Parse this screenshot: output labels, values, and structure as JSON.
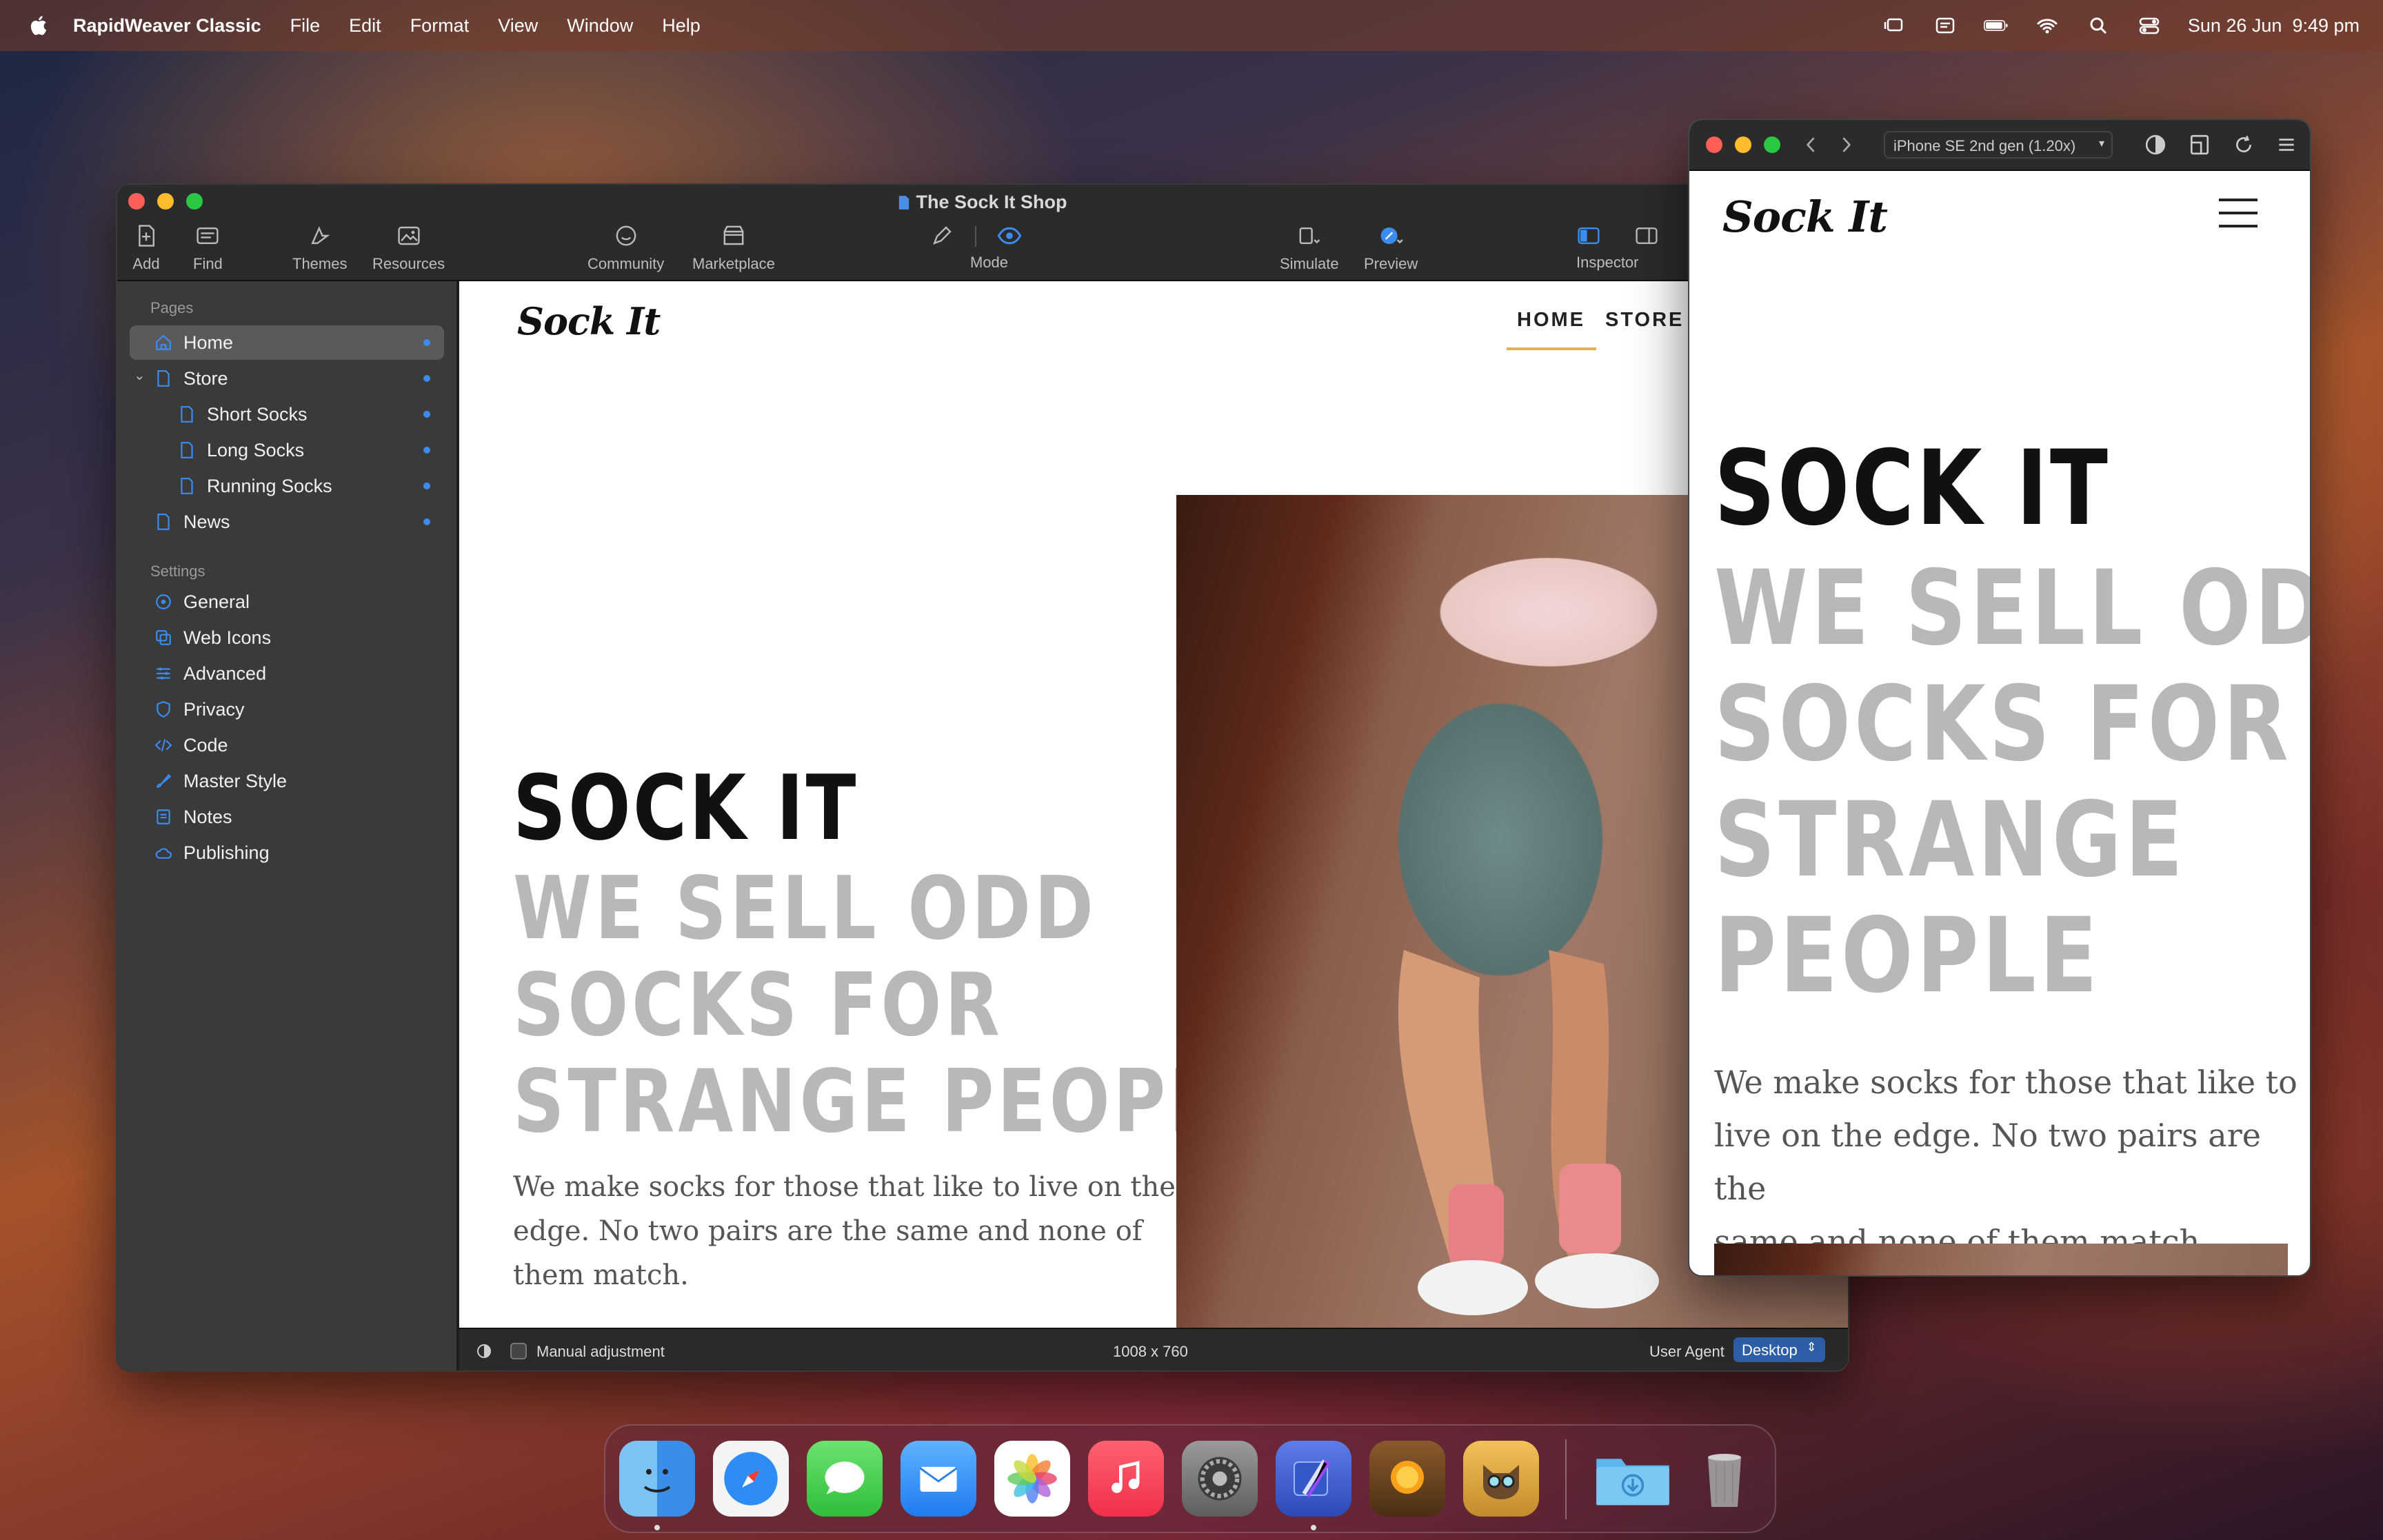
{
  "menubar": {
    "app_name": "RapidWeaver Classic",
    "menus": [
      "File",
      "Edit",
      "Format",
      "View",
      "Window",
      "Help"
    ],
    "datetime": "Sun 26 Jun  9:49 pm",
    "status_icons": [
      "stage-manager-icon",
      "shield-icon",
      "battery-icon",
      "wifi-icon",
      "spotlight-icon",
      "control-center-icon"
    ]
  },
  "window": {
    "title": "The Sock It Shop",
    "toolbar": {
      "add": "Add",
      "find": "Find",
      "themes": "Themes",
      "resources": "Resources",
      "community": "Community",
      "marketplace": "Marketplace",
      "mode": "Mode",
      "simulate": "Simulate",
      "preview": "Preview",
      "inspector": "Inspector"
    },
    "sidebar": {
      "pages_header": "Pages",
      "pages": [
        "Home",
        "Store",
        "Short Socks",
        "Long Socks",
        "Running Socks",
        "News"
      ],
      "settings_header": "Settings",
      "settings": [
        "General",
        "Web Icons",
        "Advanced",
        "Privacy",
        "Code",
        "Master Style",
        "Notes",
        "Publishing"
      ]
    },
    "page": {
      "logo": "Sock It",
      "nav": [
        "HOME",
        "STORE"
      ],
      "heading": "SOCK IT",
      "sub": [
        "WE SELL ODD",
        "SOCKS FOR",
        "STRANGE PEOPLE"
      ],
      "body": [
        "We make socks for those that like to live on the",
        "edge. No two pairs are the same and none of",
        "them match."
      ]
    },
    "status": {
      "manual": "Manual adjustment",
      "size": "1008 x 760",
      "ua_label": "User Agent",
      "ua_value": "Desktop"
    }
  },
  "preview": {
    "device": "iPhone SE 2nd gen (1.20x)",
    "logo": "Sock It",
    "heading": "SOCK IT",
    "sub": [
      "WE SELL ODD",
      "SOCKS FOR",
      "STRANGE",
      "PEOPLE"
    ],
    "body": [
      "We make socks for those that like to",
      "live on the edge. No two pairs are the",
      "same and none of them match."
    ]
  },
  "dock": {
    "apps": [
      "finder-icon",
      "safari-icon",
      "messages-icon",
      "mail-icon",
      "photos-icon",
      "music-icon",
      "system-settings-icon",
      "rapidweaver-icon",
      "squash-icon",
      "ragdoll-icon",
      "downloads-folder-icon",
      "trash-icon"
    ]
  },
  "colors": {
    "accent": "#3b8cf0",
    "nav_underline": "#e0b15a"
  }
}
